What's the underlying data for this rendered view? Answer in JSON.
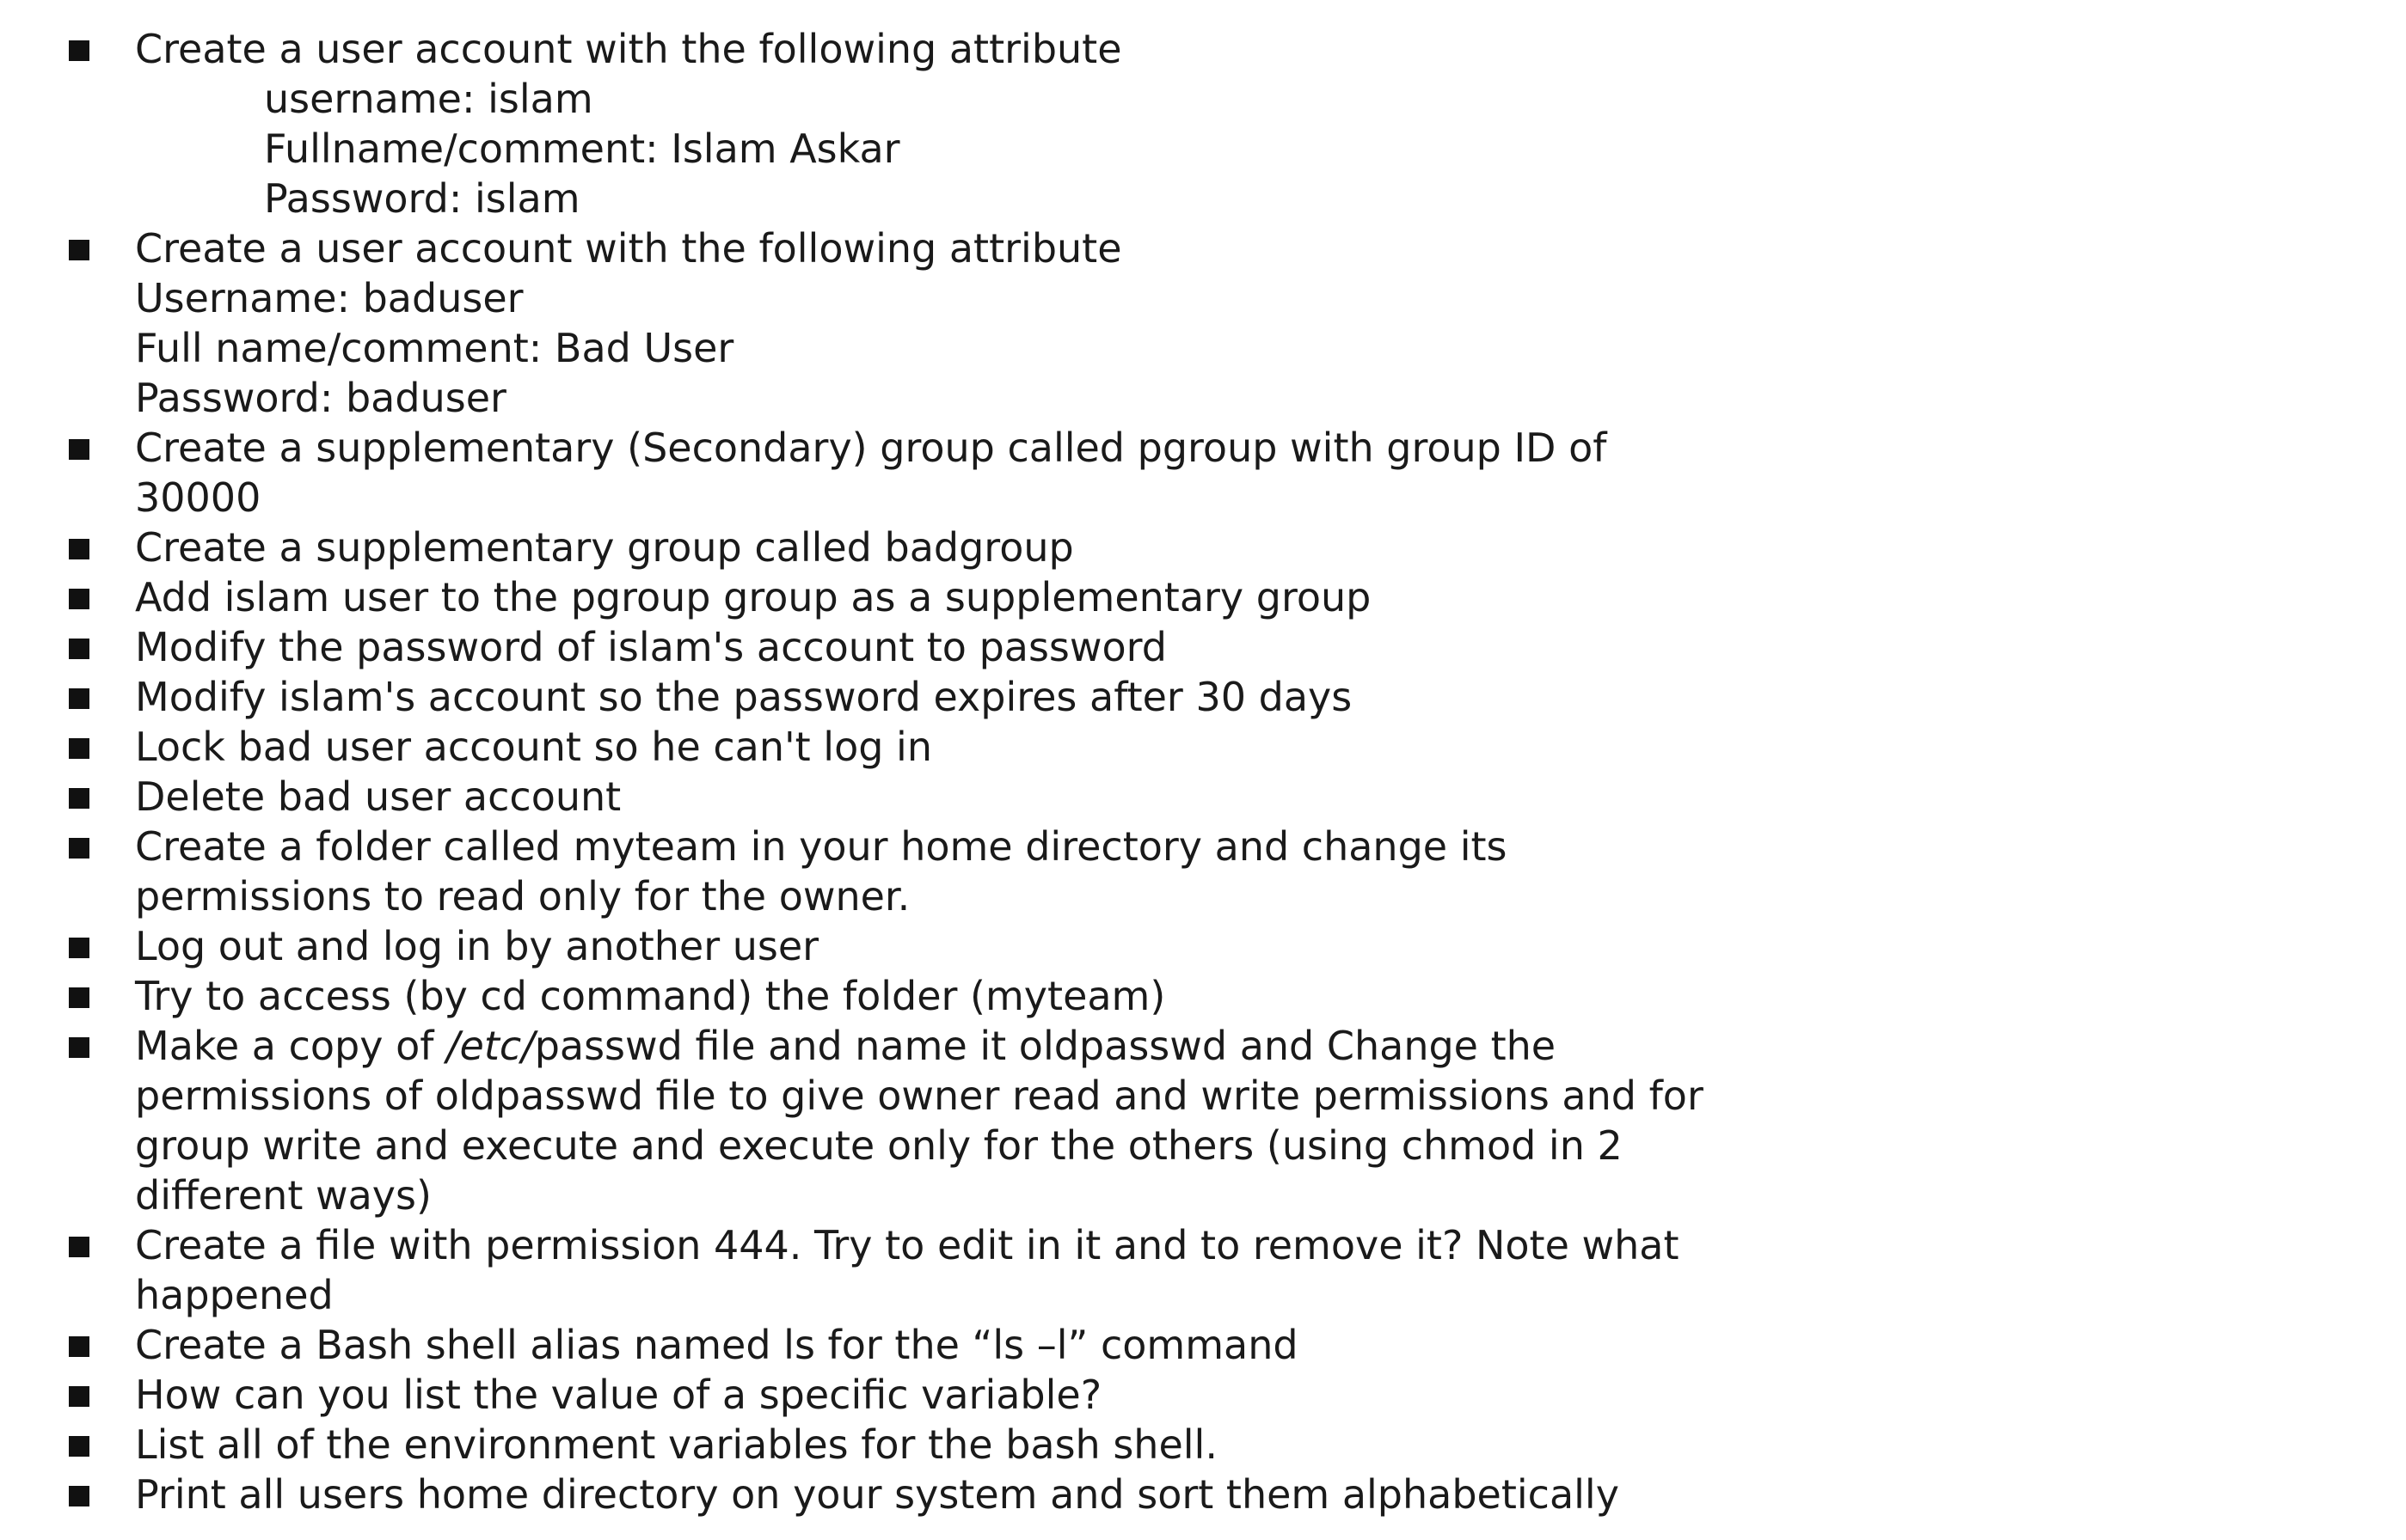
{
  "items": [
    {
      "lines": [
        {
          "text": "Create a user account with the following attribute"
        },
        {
          "text": "username: islam",
          "indent": true
        },
        {
          "text": "Fullname/comment: Islam Askar",
          "indent": true
        },
        {
          "text": "Password: islam",
          "indent": true
        }
      ]
    },
    {
      "lines": [
        {
          "text": "Create a user account with the following attribute"
        },
        {
          "text": "Username: baduser"
        },
        {
          "text": "Full name/comment: Bad User"
        },
        {
          "text": "Password: baduser"
        }
      ]
    },
    {
      "lines": [
        {
          "text": "Create a supplementary (Secondary) group called pgroup with group ID of"
        },
        {
          "text": "30000"
        }
      ]
    },
    {
      "lines": [
        {
          "text": "Create a supplementary group called badgroup"
        }
      ]
    },
    {
      "lines": [
        {
          "text": "Add islam user to the pgroup group as a supplementary group"
        }
      ]
    },
    {
      "lines": [
        {
          "text": "Modify the password of islam's account to password"
        }
      ]
    },
    {
      "lines": [
        {
          "text": "Modify islam's account so the password expires after 30 days"
        }
      ]
    },
    {
      "lines": [
        {
          "text": "Lock bad user account so he can't log in"
        }
      ]
    },
    {
      "lines": [
        {
          "text": "Delete bad user account"
        }
      ]
    },
    {
      "lines": [
        {
          "text": "Create a folder called myteam in your home directory and change its"
        },
        {
          "text": "permissions to read only for the owner."
        }
      ]
    },
    {
      "lines": [
        {
          "text": "Log out and log in by another user"
        }
      ]
    },
    {
      "lines": [
        {
          "text": "Try to access (by cd command) the folder (myteam)"
        }
      ]
    },
    {
      "lines": [
        {
          "parts": [
            {
              "text": "Make a copy of "
            },
            {
              "text": "/etc/",
              "italic": true
            },
            {
              "text": "passwd file and name it oldpasswd and Change the"
            }
          ]
        },
        {
          "text": "permissions of oldpasswd file to give owner read and write permissions and for"
        },
        {
          "text": "group write and execute and execute only for the others (using chmod in 2"
        },
        {
          "text": "different ways)"
        }
      ]
    },
    {
      "lines": [
        {
          "text": "Create a file with permission 444. Try to edit in it and to remove it? Note what"
        },
        {
          "text": "happened"
        }
      ]
    },
    {
      "lines": [
        {
          "text": "Create a Bash shell alias named ls for the “ls –l” command"
        }
      ]
    },
    {
      "lines": [
        {
          "text": "How can you list the value of a specific variable?"
        }
      ]
    },
    {
      "lines": [
        {
          "text": "List all of the environment variables for the bash shell."
        }
      ]
    },
    {
      "lines": [
        {
          "text": "Print all users home directory on your system and sort them alphabetically"
        }
      ]
    }
  ]
}
